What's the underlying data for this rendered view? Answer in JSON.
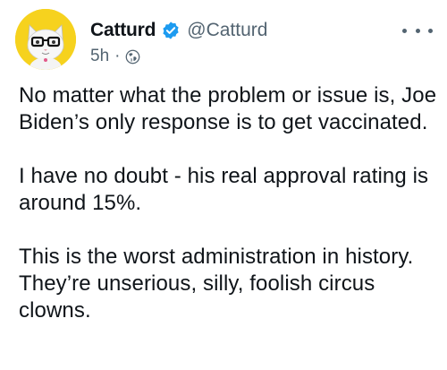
{
  "author": {
    "name": "Catturd",
    "handle": "@Catturd",
    "verified": true
  },
  "meta": {
    "time": "5h",
    "separator": "·",
    "audience_icon": "globe-icon"
  },
  "tweet": {
    "paragraphs": [
      "No matter what the problem or issue is, Joe Biden’s only response is to get vaccinated.",
      "I have no doubt - his real approval rating is around 15%.",
      "This is the worst administration in history. They’re unserious, silly, foolish circus clowns."
    ]
  },
  "colors": {
    "verified": "#1d9bf0",
    "secondary_text": "#536471",
    "primary_text": "#0f1419",
    "avatar_bg": "#f6d21e"
  }
}
